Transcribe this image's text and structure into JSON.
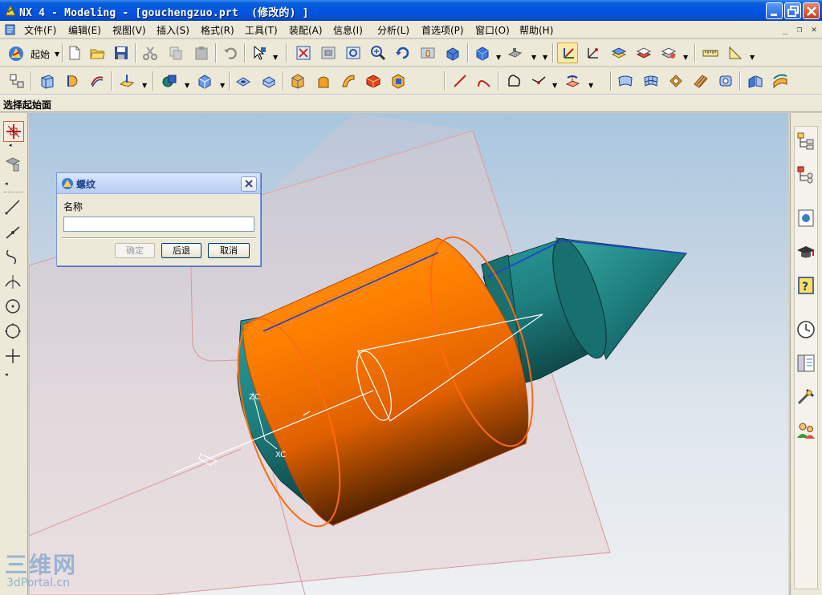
{
  "window": {
    "title": "NX 4 - Modeling - [gouchengzuo.prt  (修改的) ]"
  },
  "menubar": {
    "items": [
      {
        "label": "文件(F)"
      },
      {
        "label": "编辑(E)"
      },
      {
        "label": "视图(V)"
      },
      {
        "label": "插入(S)"
      },
      {
        "label": "格式(R)"
      },
      {
        "label": "工具(T)"
      },
      {
        "label": "装配(A)"
      },
      {
        "label": "信息(I)"
      },
      {
        "label": "分析(L)"
      },
      {
        "label": "首选项(P)"
      },
      {
        "label": "窗口(O)"
      },
      {
        "label": "帮助(H)"
      }
    ]
  },
  "toolbar": {
    "start_label": "起始"
  },
  "prompt": {
    "text": "选择起始面"
  },
  "viewport": {
    "axis_labels": {
      "zc": "ZC",
      "xc": "XC"
    },
    "colors": {
      "orange": "#ff8000",
      "teal": "#1e7f7f",
      "plane": "#e0a0a0",
      "highlight": "#2040d0"
    }
  },
  "dialog": {
    "title": "螺纹",
    "name_label": "名称",
    "name_value": "",
    "ok_label": "确定",
    "back_label": "后退",
    "cancel_label": "取消"
  },
  "watermark": {
    "text_cn": "三维网",
    "url": "3dPortal.cn"
  }
}
